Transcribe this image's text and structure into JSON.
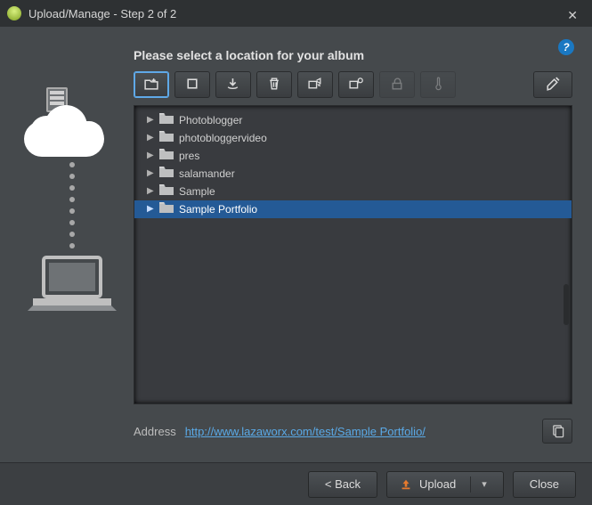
{
  "window": {
    "title": "Upload/Manage - Step 2 of 2"
  },
  "prompt": "Please select a location for your album",
  "toolbar": [
    {
      "id": "new-folder",
      "enabled": true,
      "active": true
    },
    {
      "id": "stop",
      "enabled": true,
      "active": false
    },
    {
      "id": "download",
      "enabled": true,
      "active": false
    },
    {
      "id": "delete",
      "enabled": true,
      "active": false
    },
    {
      "id": "share-out",
      "enabled": true,
      "active": false
    },
    {
      "id": "share-in",
      "enabled": true,
      "active": false
    },
    {
      "id": "lock",
      "enabled": false,
      "active": false
    },
    {
      "id": "temperature",
      "enabled": false,
      "active": false
    },
    {
      "id": "settings",
      "enabled": true,
      "active": false
    }
  ],
  "tree": {
    "items": [
      {
        "label": "Photoblogger",
        "selected": false
      },
      {
        "label": "photobloggervideo",
        "selected": false
      },
      {
        "label": "pres",
        "selected": false
      },
      {
        "label": "salamander",
        "selected": false
      },
      {
        "label": "Sample",
        "selected": false
      },
      {
        "label": "Sample Portfolio",
        "selected": true
      }
    ]
  },
  "address": {
    "label": "Address",
    "url": "http://www.lazaworx.com/test/Sample Portfolio/"
  },
  "footer": {
    "back": "< Back",
    "upload": "Upload",
    "close": "Close"
  }
}
